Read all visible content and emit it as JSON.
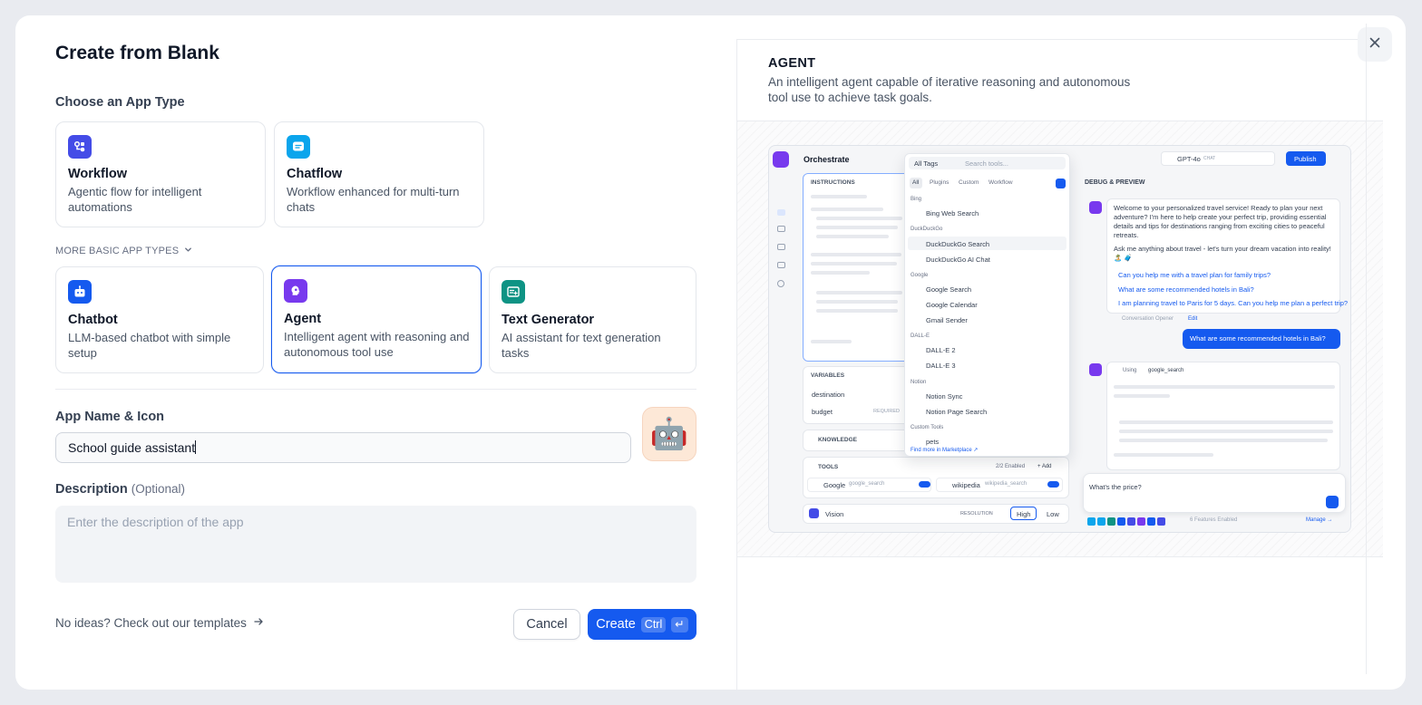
{
  "dialog": {
    "title": "Create from Blank",
    "close_icon": "close-icon"
  },
  "app_type": {
    "label": "Choose an App Type",
    "primary": [
      {
        "title": "Workflow",
        "desc": "Agentic flow for intelligent automations",
        "icon": "workflow-icon",
        "color": "#444ce7"
      },
      {
        "title": "Chatflow",
        "desc": "Workflow enhanced for multi-turn chats",
        "icon": "chatflow-icon",
        "color": "#0ba5ec"
      }
    ],
    "more_label": "MORE BASIC APP TYPES",
    "basic": [
      {
        "title": "Chatbot",
        "desc": "LLM-based chatbot with simple setup",
        "icon": "chatbot-icon",
        "color": "#155aef"
      },
      {
        "title": "Agent",
        "desc": "Intelligent agent with reasoning and autonomous tool use",
        "icon": "agent-icon",
        "color": "#7839ee",
        "selected": true
      },
      {
        "title": "Text Generator",
        "desc": "AI assistant for text generation tasks",
        "icon": "text-generator-icon",
        "color": "#0e9384"
      }
    ]
  },
  "name_icon": {
    "label": "App Name & Icon",
    "value": "School guide assistant",
    "icon": "🤖"
  },
  "description": {
    "label": "Description",
    "optional": "(Optional)",
    "placeholder": "Enter the description of the app"
  },
  "footer": {
    "templates_link": "No ideas? Check out our templates",
    "cancel": "Cancel",
    "create": "Create",
    "kbd_ctrl": "Ctrl",
    "kbd_enter": "↵"
  },
  "preview": {
    "title": "AGENT",
    "desc": "An intelligent agent capable of iterative reasoning and autonomous tool use to achieve task goals.",
    "screenshot": {
      "header": "Orchestrate",
      "instructions": "INSTRUCTIONS",
      "variables": "VARIABLES",
      "var1": "destination",
      "var2": "budget",
      "required": "REQUIRED",
      "knowledge": "KNOWLEDGE",
      "tools": "TOOLS",
      "tools_enabled": "2/2 Enabled",
      "add": "+ Add",
      "tool1": "Google",
      "tool1_sub": "google_search",
      "tool2": "wikipedia",
      "tool2_sub": "wikipedia_search",
      "vision": "Vision",
      "resolution": "RESOLUTION",
      "high": "High",
      "low": "Low",
      "all_tags": "All Tags",
      "search_tools": "Search tools...",
      "filter_tabs": [
        "All",
        "Plugins",
        "Custom",
        "Workflow"
      ],
      "groups": [
        {
          "name": "Bing",
          "items": [
            "Bing Web Search"
          ]
        },
        {
          "name": "DuckDuckGo",
          "items": [
            "DuckDuckGo Search",
            "DuckDuckGo AI Chat"
          ]
        },
        {
          "name": "Google",
          "items": [
            "Google Search",
            "Google Calendar",
            "Gmail Sender"
          ]
        },
        {
          "name": "DALL-E",
          "items": [
            "DALL-E 2",
            "DALL-E 3"
          ]
        },
        {
          "name": "Notion",
          "items": [
            "Notion Sync",
            "Notion Page Search"
          ]
        },
        {
          "name": "Custom Tools",
          "items": [
            "pets"
          ]
        }
      ],
      "marketplace": "Find more in Marketplace ↗",
      "model": "GPT-4o",
      "chat_tag": "CHAT",
      "publish": "Publish",
      "debug": "DEBUG & PREVIEW",
      "welcome": "Welcome to your personalized travel service! Ready to plan your next adventure? I'm here to help create your perfect trip, providing essential details and tips for destinations ranging from exciting cities to peaceful retreats.",
      "ask": "Ask me anything about travel - let's turn your dream vacation into reality! 🏝️ 🧳",
      "sugg1": "Can you help me with a travel plan for family trips?",
      "sugg2": "What are some recommended hotels in Bali?",
      "sugg3": "I am planning travel to Paris for 5 days. Can you help me plan a perfect trip?",
      "opener": "Conversation Opener",
      "edit": "Edit",
      "user_msg": "What are some recommended hotels in Bali?",
      "using": "Using",
      "using_tool": "google_search",
      "input": "What's the price?",
      "features": "6 Features Enabled",
      "manage": "Manage →"
    }
  }
}
